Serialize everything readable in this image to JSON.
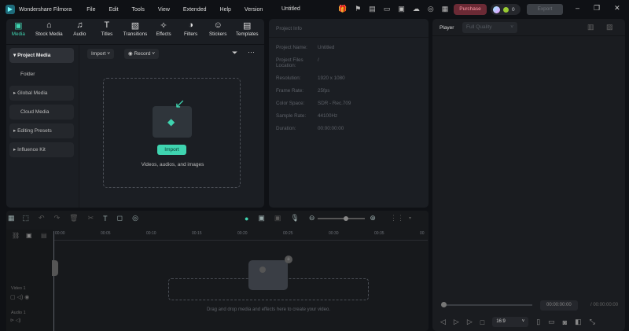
{
  "app": {
    "name": "Wondershare Filmora",
    "document_title": "Untitled",
    "menu": [
      "File",
      "Edit",
      "Tools",
      "View",
      "Extended",
      "Help",
      "Version"
    ],
    "purchase": "Purchase",
    "credits": "0",
    "export": "Export"
  },
  "tabs": [
    {
      "label": "Media",
      "icon": "media-icon",
      "active": true
    },
    {
      "label": "Stock Media",
      "icon": "stock-icon"
    },
    {
      "label": "Audio",
      "icon": "music-icon"
    },
    {
      "label": "Titles",
      "icon": "title-icon"
    },
    {
      "label": "Transitions",
      "icon": "transition-icon"
    },
    {
      "label": "Effects",
      "icon": "effects-icon"
    },
    {
      "label": "Filters",
      "icon": "filter-icon"
    },
    {
      "label": "Stickers",
      "icon": "sticker-icon"
    },
    {
      "label": "Templates",
      "icon": "template-icon"
    }
  ],
  "sidebar": [
    {
      "label": "Project Media",
      "arrow": true,
      "active": true
    },
    {
      "label": "Folder"
    },
    {
      "label": "Global Media",
      "arrow": true
    },
    {
      "label": "Cloud Media"
    },
    {
      "label": "Editing Presets",
      "arrow": true
    },
    {
      "label": "Influence Kit",
      "arrow": true
    }
  ],
  "media": {
    "import": "Import",
    "record": "Record",
    "import_button": "Import",
    "drop_text": "Videos, audios, and images"
  },
  "project_info": {
    "title": "Project Info",
    "rows": [
      {
        "k": "Project Name:",
        "v": "Untitled"
      },
      {
        "k": "Project Files Location:",
        "v": "/"
      },
      {
        "k": "Resolution:",
        "v": "1920 x 1080"
      },
      {
        "k": "Frame Rate:",
        "v": "25fps"
      },
      {
        "k": "Color Space:",
        "v": "SDR - Rec.709"
      },
      {
        "k": "Sample Rate:",
        "v": "44100Hz"
      },
      {
        "k": "Duration:",
        "v": "00:00:00:00"
      }
    ]
  },
  "player": {
    "label": "Player",
    "quality": "Full Quality",
    "current_time": "00:00:00:00",
    "total_time": "/ 00:00:00:00",
    "aspect": "16:9"
  },
  "timeline": {
    "ruler": [
      "00:00",
      "00:05",
      "00:10",
      "00:15",
      "00:20",
      "00:25",
      "00:30",
      "00:35",
      "00"
    ],
    "video_track": "Video 1",
    "audio_track": "Audio 1",
    "drop_text": "Drag and drop media and effects here to create your video.",
    "zoom_level": 0.6
  }
}
